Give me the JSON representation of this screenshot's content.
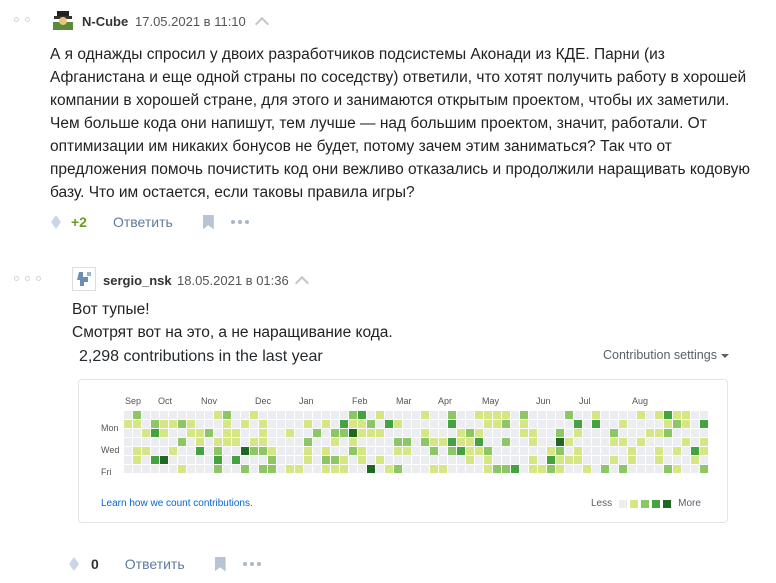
{
  "comment1": {
    "author": "N-Cube",
    "time": "17.05.2021 в 11:10",
    "text": "А я однажды спросил у двоих разработчиков подсистемы Аконади из КДЕ. Парни (из Афганистана и еще одной страны по соседству) ответили, что хотят получить работу в хорошей компании в хорошей стране, для этого и занимаются открытым проектом, чтобы их заметили. Чем больше кода они напишут, тем лучше — над большим проектом, значит, работали. От оптимизации им никаких бонусов не будет, потому зачем этим заниматься? Так что от предложения помочь почистить код они вежливо отказались и продолжили наращивать кодовую базу. Что им остается, если таковы правила игры?",
    "score": "+2",
    "reply_label": "Ответить"
  },
  "comment2": {
    "author": "sergio_nsk",
    "time": "18.05.2021 в 01:36",
    "line1": "Вот тупые!",
    "line2": "Смотрят вот на это, а не наращивание кода.",
    "score": "0",
    "reply_label": "Ответить"
  },
  "contributions": {
    "title": "2,298 contributions in the last year",
    "settings_label": "Contribution settings",
    "months": [
      "Sep",
      "Oct",
      "Nov",
      "Dec",
      "Jan",
      "Feb",
      "Mar",
      "Apr",
      "May",
      "Jun",
      "Jul",
      "Aug"
    ],
    "weekdays": [
      "Mon",
      "Wed",
      "Fri"
    ],
    "learn_link": "Learn how we count contributions.",
    "legend_less": "Less",
    "legend_more": "More",
    "colors": [
      "#ebedf0",
      "#d6e685",
      "#8cc665",
      "#44a340",
      "#1e6823"
    ]
  },
  "icons": {
    "upvote": "drop-icon",
    "bookmark": "bookmark-icon",
    "more": "more-dots-icon",
    "collapse": "chevron-up-icon"
  }
}
